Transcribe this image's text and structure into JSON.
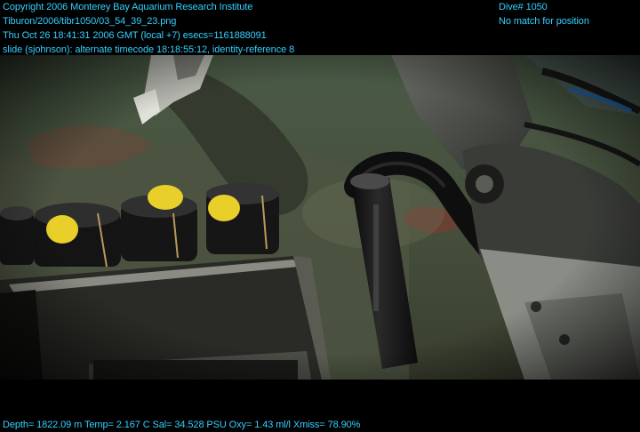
{
  "overlay": {
    "top_left": [
      "Copyright 2006 Monterey Bay Aquarium Research Institute",
      "Tiburon/2006/tibr1050/03_54_39_23.png",
      "Thu Oct 26 18:41:31 2006 GMT (local +7)  esecs=1161888091",
      "slide (sjohnson): alternate timecode 18:18:55:12, identity-reference 8"
    ],
    "top_right": [
      "Dive# 1050",
      "No match for position"
    ],
    "bottom": "Depth= 1822.09 m  Temp= 2.167 C  Sal= 34.528 PSU  Oxy= 1.43 ml/l  Xmiss= 78.90%"
  },
  "colors": {
    "overlay_text": "#35d0ff",
    "water": "#3c4a37",
    "seafloor": "#4f5540",
    "rope_yellow": "#e8cf2a"
  }
}
